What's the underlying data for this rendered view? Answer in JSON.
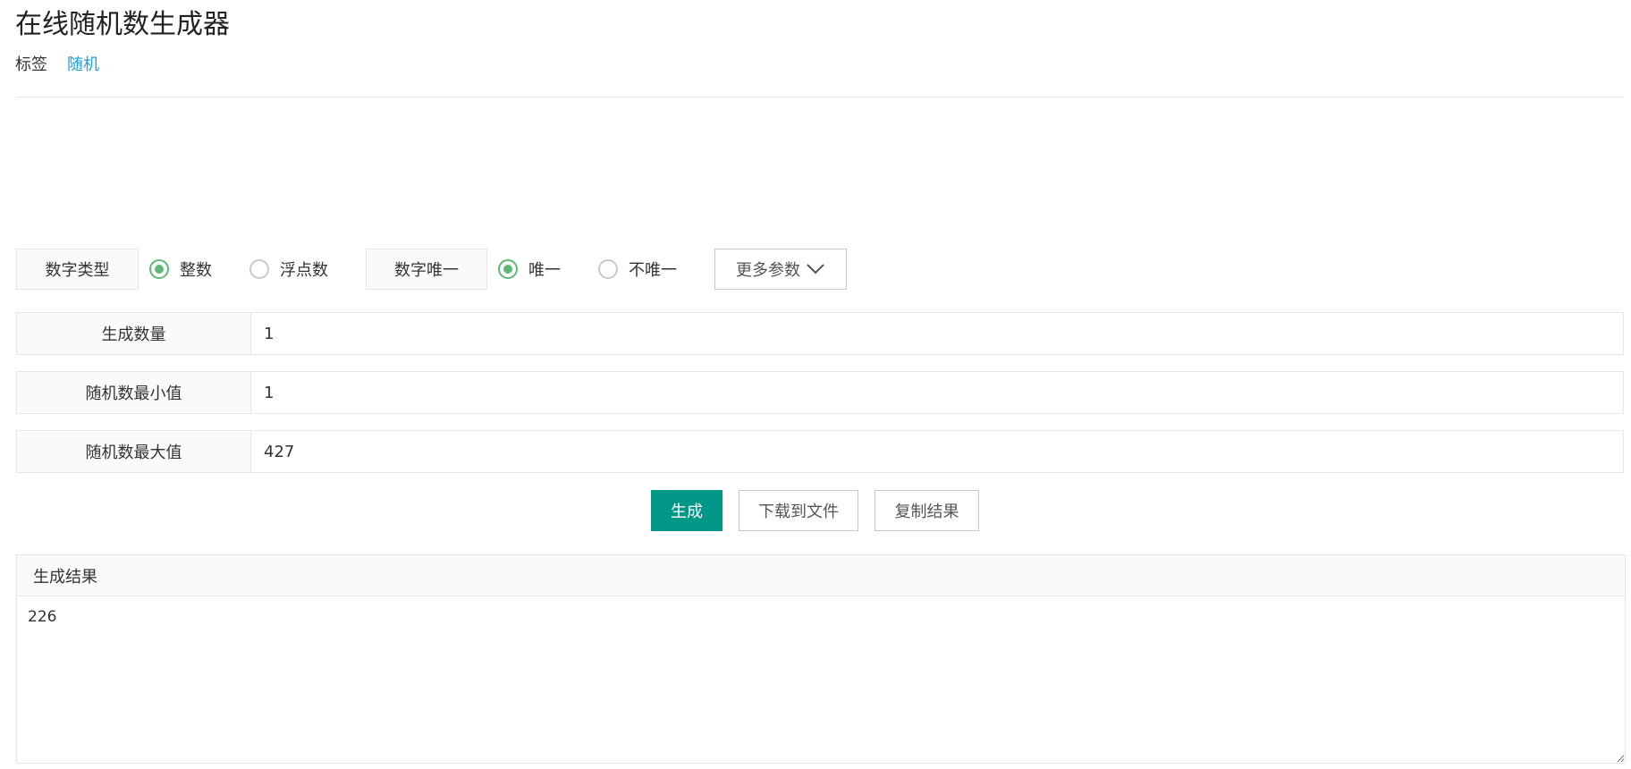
{
  "page": {
    "title": "在线随机数生成器",
    "tag_label": "标签",
    "tag_link": "随机"
  },
  "options": {
    "number_type_label": "数字类型",
    "integer_label": "整数",
    "float_label": "浮点数",
    "integer_checked": true,
    "float_checked": false,
    "unique_label": "数字唯一",
    "unique_yes_label": "唯一",
    "unique_no_label": "不唯一",
    "unique_yes_checked": true,
    "unique_no_checked": false,
    "more_params_label": "更多参数"
  },
  "form": {
    "count_label": "生成数量",
    "count_value": "1",
    "min_label": "随机数最小值",
    "min_value": "1",
    "max_label": "随机数最大值",
    "max_value": "427"
  },
  "actions": {
    "generate_label": "生成",
    "download_label": "下载到文件",
    "copy_label": "复制结果"
  },
  "result": {
    "header": "生成结果",
    "value": "226"
  },
  "colors": {
    "primary": "#009688",
    "radio_checked": "#5fb878",
    "link": "#1e9fd6",
    "border": "#e6e6e6"
  }
}
